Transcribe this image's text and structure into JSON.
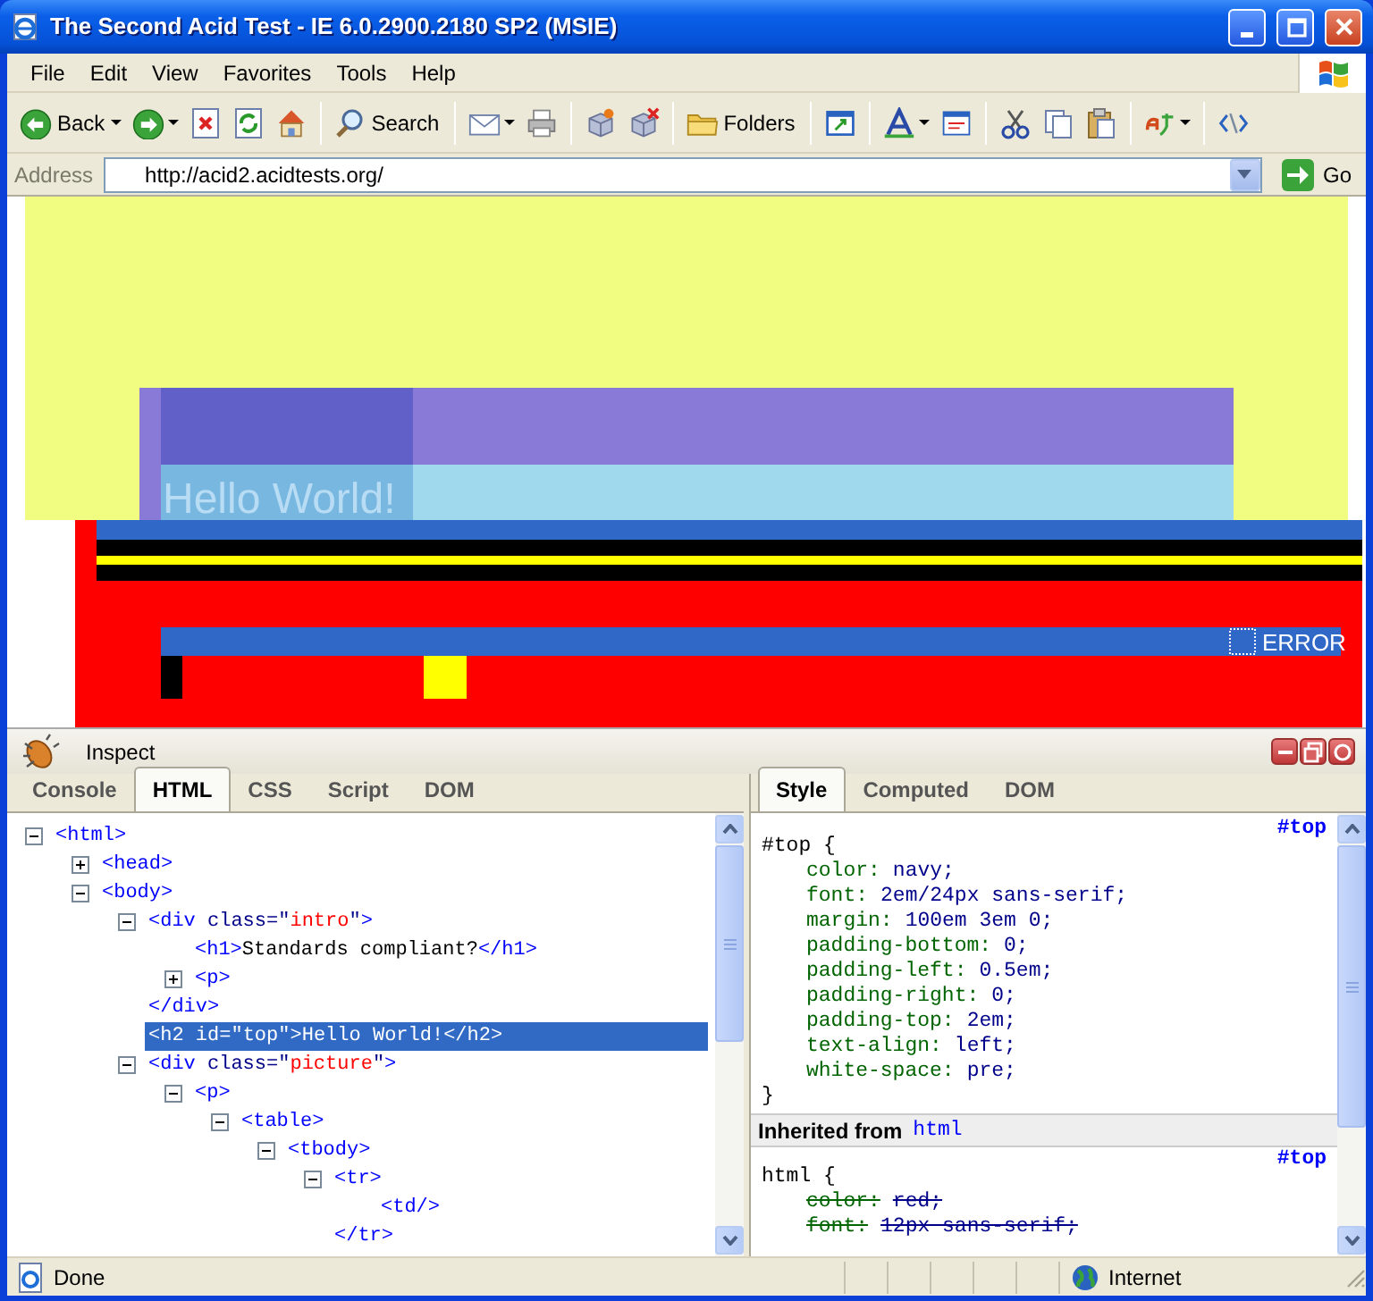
{
  "window": {
    "title": "The Second Acid Test - IE 6.0.2900.2180 SP2 (MSIE)"
  },
  "menu": [
    "File",
    "Edit",
    "View",
    "Favorites",
    "Tools",
    "Help"
  ],
  "toolbar": [
    [
      {
        "kind": "back",
        "label": "Back",
        "dropdown": true
      },
      {
        "kind": "forward",
        "dropdown": true
      },
      {
        "kind": "stop",
        "dropdown": false
      },
      {
        "kind": "refresh",
        "dropdown": false
      },
      {
        "kind": "home",
        "dropdown": false
      }
    ],
    [
      {
        "kind": "search",
        "label": "Search",
        "dropdown": false
      }
    ],
    [
      {
        "kind": "mail",
        "dropdown": true
      },
      {
        "kind": "print",
        "dropdown": false
      }
    ],
    [
      {
        "kind": "cube-add",
        "dropdown": false
      },
      {
        "kind": "cube-remove",
        "dropdown": false
      }
    ],
    [
      {
        "kind": "folders",
        "label": "Folders",
        "dropdown": false
      }
    ],
    [
      {
        "kind": "window",
        "dropdown": false
      }
    ],
    [
      {
        "kind": "font",
        "dropdown": true
      },
      {
        "kind": "edit",
        "dropdown": false
      }
    ],
    [
      {
        "kind": "cut",
        "dropdown": false
      },
      {
        "kind": "copy",
        "dropdown": false
      },
      {
        "kind": "paste",
        "dropdown": false
      }
    ],
    [
      {
        "kind": "translate",
        "dropdown": true
      }
    ],
    [
      {
        "kind": "code",
        "dropdown": false
      }
    ]
  ],
  "address": {
    "label": "Address",
    "value": "http://acid2.acidtests.org/",
    "go": "Go"
  },
  "page": {
    "heading": "Hello World!",
    "error": "ERROR"
  },
  "devtools": {
    "title": "Inspect",
    "tabs": [
      {
        "label": "Console",
        "selected": false
      },
      {
        "label": "HTML",
        "selected": true
      },
      {
        "label": "CSS",
        "selected": false
      },
      {
        "label": "Script",
        "selected": false
      },
      {
        "label": "DOM",
        "selected": false
      }
    ],
    "tree": [
      {
        "parts": [
          {
            "kind": "tag",
            "text": "<html>"
          }
        ],
        "expanded": true,
        "selected": false,
        "children": [
          {
            "parts": [
              {
                "kind": "tag",
                "text": "<head>"
              }
            ],
            "expanded": false,
            "selected": false
          },
          {
            "parts": [
              {
                "kind": "tag",
                "text": "<body>"
              }
            ],
            "expanded": true,
            "selected": false,
            "children": [
              {
                "parts": [
                  {
                    "kind": "tag",
                    "text": "<div"
                  },
                  {
                    "kind": "attr",
                    "text": " class"
                  },
                  {
                    "kind": "attr",
                    "text": "=\""
                  },
                  {
                    "kind": "value",
                    "text": "intro"
                  },
                  {
                    "kind": "attr",
                    "text": "\""
                  },
                  {
                    "kind": "tag",
                    "text": ">"
                  }
                ],
                "expanded": true,
                "selected": false,
                "children": [
                  {
                    "parts": [
                      {
                        "kind": "tag",
                        "text": "<h1>"
                      },
                      {
                        "kind": "text",
                        "text": "Standards compliant?"
                      },
                      {
                        "kind": "tag",
                        "text": "</h1>"
                      }
                    ],
                    "selected": false
                  },
                  {
                    "parts": [
                      {
                        "kind": "tag",
                        "text": "<p>"
                      }
                    ],
                    "expanded": false,
                    "selected": false
                  }
                ],
                "close": [
                  {
                    "kind": "tag",
                    "text": "</div>"
                  }
                ]
              },
              {
                "parts": [
                  {
                    "kind": "tag",
                    "text": "<h2"
                  },
                  {
                    "kind": "attr",
                    "text": " id"
                  },
                  {
                    "kind": "attr",
                    "text": "=\""
                  },
                  {
                    "kind": "value",
                    "text": "top"
                  },
                  {
                    "kind": "attr",
                    "text": "\""
                  },
                  {
                    "kind": "tag",
                    "text": ">"
                  },
                  {
                    "kind": "text",
                    "text": "Hello World!"
                  },
                  {
                    "kind": "tag",
                    "text": "</h2>"
                  }
                ],
                "selected": true
              },
              {
                "parts": [
                  {
                    "kind": "tag",
                    "text": "<div"
                  },
                  {
                    "kind": "attr",
                    "text": " class"
                  },
                  {
                    "kind": "attr",
                    "text": "=\""
                  },
                  {
                    "kind": "value",
                    "text": "picture"
                  },
                  {
                    "kind": "attr",
                    "text": "\""
                  },
                  {
                    "kind": "tag",
                    "text": ">"
                  }
                ],
                "expanded": true,
                "selected": false,
                "children": [
                  {
                    "parts": [
                      {
                        "kind": "tag",
                        "text": "<p>"
                      }
                    ],
                    "expanded": true,
                    "selected": false,
                    "children": [
                      {
                        "parts": [
                          {
                            "kind": "tag",
                            "text": "<table>"
                          }
                        ],
                        "expanded": true,
                        "selected": false,
                        "children": [
                          {
                            "parts": [
                              {
                                "kind": "tag",
                                "text": "<tbody>"
                              }
                            ],
                            "expanded": true,
                            "selected": false,
                            "children": [
                              {
                                "parts": [
                                  {
                                    "kind": "tag",
                                    "text": "<tr>"
                                  }
                                ],
                                "expanded": true,
                                "selected": false,
                                "children": [
                                  {
                                    "parts": [
                                      {
                                        "kind": "tag",
                                        "text": "<td/>"
                                      }
                                    ],
                                    "selected": false
                                  }
                                ],
                                "close": [
                                  {
                                    "kind": "tag",
                                    "text": "</tr>"
                                  }
                                ]
                              }
                            ]
                          }
                        ]
                      }
                    ]
                  }
                ]
              }
            ]
          }
        ]
      }
    ],
    "side_tabs": [
      {
        "label": "Style",
        "selected": true
      },
      {
        "label": "Computed",
        "selected": false
      },
      {
        "label": "DOM",
        "selected": false
      }
    ],
    "rules": [
      {
        "kind": "rule",
        "link": "#top",
        "selector": "#top {",
        "props": [
          {
            "name": "color:",
            "value": "navy;",
            "overridden": false
          },
          {
            "name": "font:",
            "value": "2em/24px sans-serif;",
            "overridden": false
          },
          {
            "name": "margin:",
            "value": "100em 3em 0;",
            "overridden": false
          },
          {
            "name": "padding-bottom:",
            "value": "0;",
            "overridden": false
          },
          {
            "name": "padding-left:",
            "value": "0.5em;",
            "overridden": false
          },
          {
            "name": "padding-right:",
            "value": "0;",
            "overridden": false
          },
          {
            "name": "padding-top:",
            "value": "2em;",
            "overridden": false
          },
          {
            "name": "text-align:",
            "value": "left;",
            "overridden": false
          },
          {
            "name": "white-space:",
            "value": "pre;",
            "overridden": false
          }
        ],
        "close": "}"
      },
      {
        "kind": "inherited",
        "label": "Inherited from",
        "source": "html"
      },
      {
        "kind": "rule",
        "link": "#top",
        "selector": "html {",
        "props": [
          {
            "name": "color:",
            "value": "red;",
            "overridden": true
          },
          {
            "name": "font:",
            "value": "12px sans-serif;",
            "overridden": true
          }
        ]
      }
    ]
  },
  "status_bar": {
    "text": "Done",
    "zone": "Internet"
  }
}
